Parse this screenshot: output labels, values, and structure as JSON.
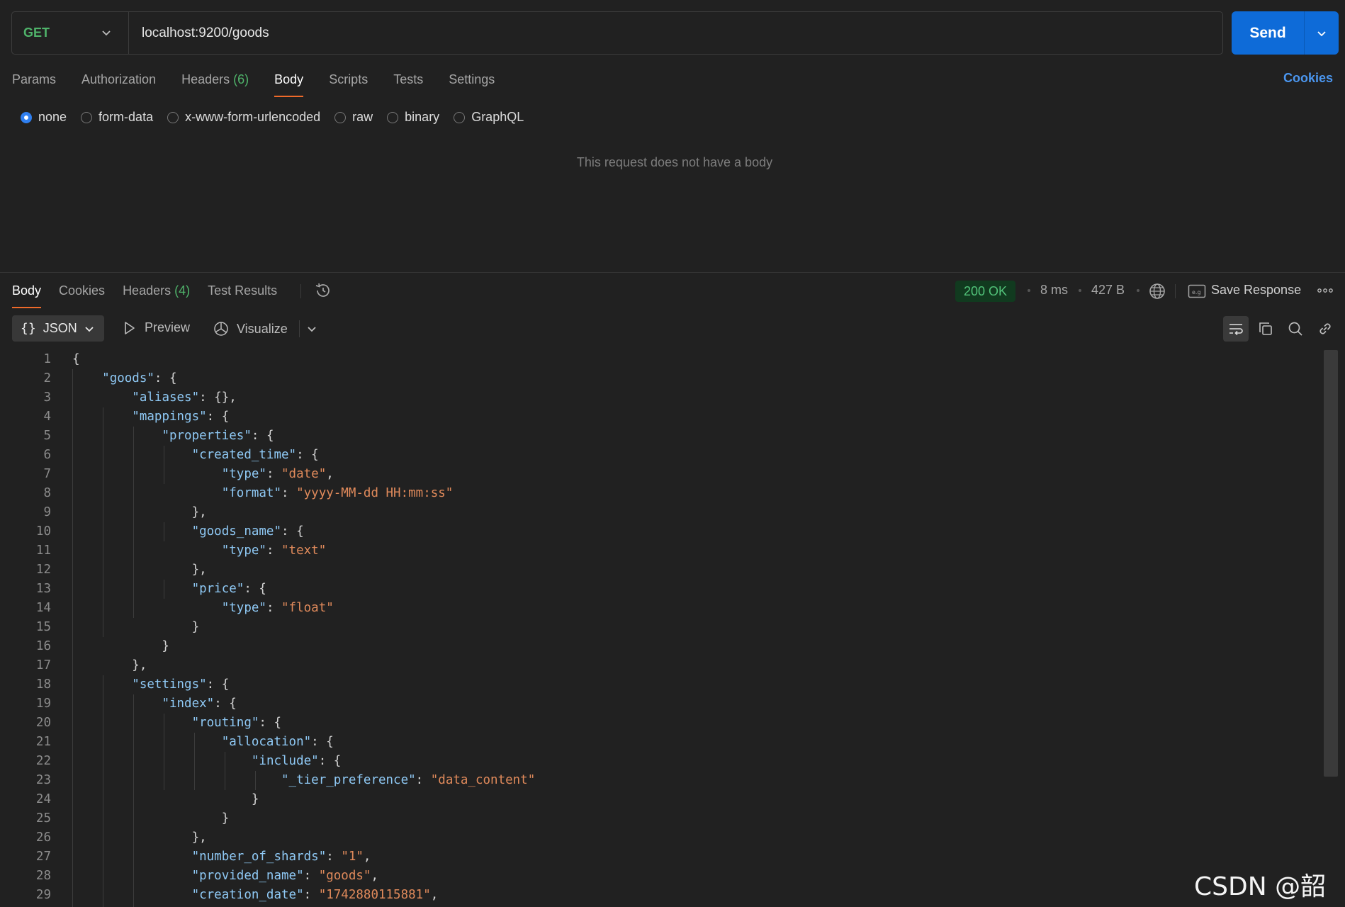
{
  "request": {
    "method": "GET",
    "url": "localhost:9200/goods",
    "send_label": "Send",
    "tabs": [
      {
        "label": "Params"
      },
      {
        "label": "Authorization"
      },
      {
        "label": "Headers",
        "count": "(6)"
      },
      {
        "label": "Body"
      },
      {
        "label": "Scripts"
      },
      {
        "label": "Tests"
      },
      {
        "label": "Settings"
      }
    ],
    "active_tab": "Body",
    "cookies_label": "Cookies",
    "body_types": [
      "none",
      "form-data",
      "x-www-form-urlencoded",
      "raw",
      "binary",
      "GraphQL"
    ],
    "selected_body_type": "none",
    "empty_body_message": "This request does not have a body"
  },
  "response": {
    "tabs": [
      {
        "label": "Body"
      },
      {
        "label": "Cookies"
      },
      {
        "label": "Headers",
        "count": "(4)"
      },
      {
        "label": "Test Results"
      }
    ],
    "active_tab": "Body",
    "status": "200 OK",
    "time": "8 ms",
    "size": "427 B",
    "save_label": "Save Response",
    "format_label": "JSON",
    "preview_label": "Preview",
    "visualize_label": "Visualize",
    "code_lines": [
      "{",
      "    \"goods\": {",
      "        \"aliases\": {},",
      "        \"mappings\": {",
      "            \"properties\": {",
      "                \"created_time\": {",
      "                    \"type\": \"date\",",
      "                    \"format\": \"yyyy-MM-dd HH:mm:ss\"",
      "                },",
      "                \"goods_name\": {",
      "                    \"type\": \"text\"",
      "                },",
      "                \"price\": {",
      "                    \"type\": \"float\"",
      "                }",
      "            }",
      "        },",
      "        \"settings\": {",
      "            \"index\": {",
      "                \"routing\": {",
      "                    \"allocation\": {",
      "                        \"include\": {",
      "                            \"_tier_preference\": \"data_content\"",
      "                        }",
      "                    }",
      "                },",
      "                \"number_of_shards\": \"1\",",
      "                \"provided_name\": \"goods\",",
      "                \"creation_date\": \"1742880115881\","
    ]
  },
  "watermark": "CSDN @韶君",
  "colors": {
    "accent_send": "#0e6bd8",
    "method_get": "#4fb36a",
    "tab_underline": "#ef6a2a",
    "json_key": "#8fc9f5",
    "json_string": "#e08a5b",
    "status_ok": "#52c37a"
  }
}
